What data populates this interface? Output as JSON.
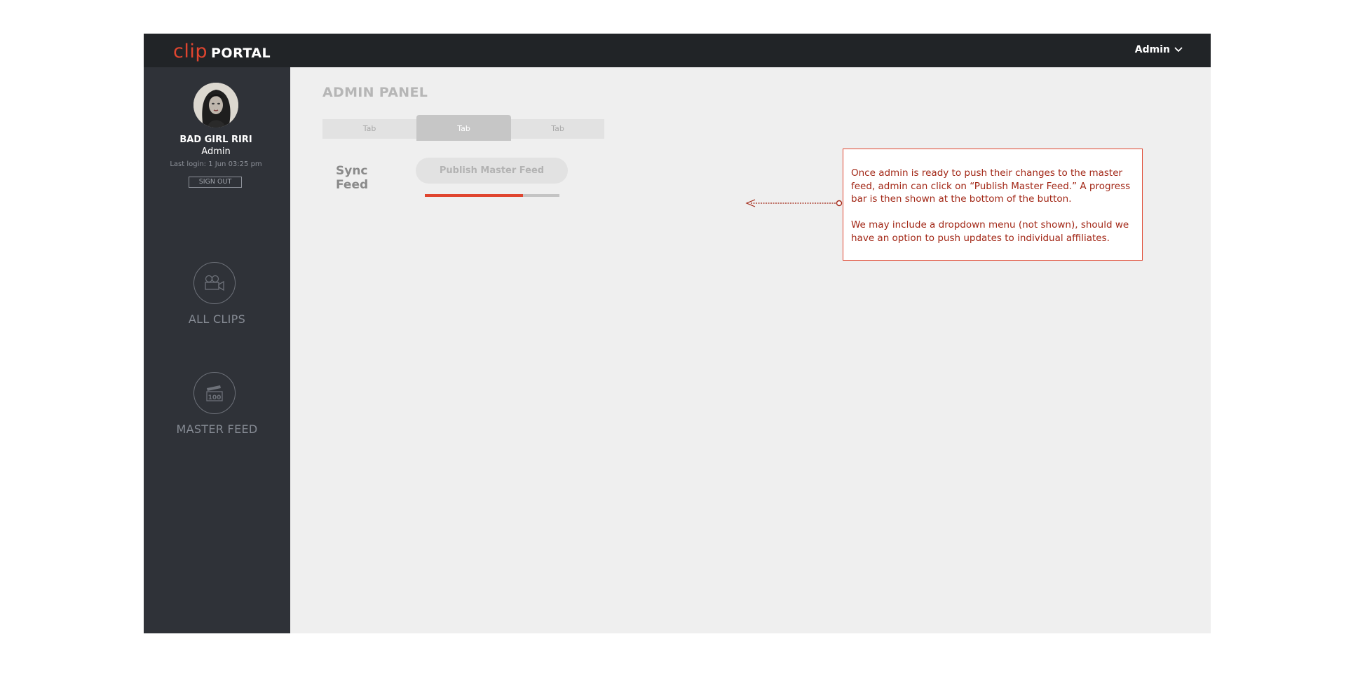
{
  "brand": {
    "clip": "clip",
    "portal": "PORTAL",
    "accent_color": "#e0452f"
  },
  "header": {
    "user_menu_label": "Admin",
    "user_menu_icon": "chevron-down-icon"
  },
  "sidebar": {
    "user": {
      "name": "BAD GIRL RIRI",
      "role": "Admin",
      "last_login": "Last login: 1 Jun 03:25 pm",
      "sign_out_label": "SIGN OUT"
    },
    "nav": [
      {
        "label": "ALL CLIPS",
        "icon": "video-camera-icon"
      },
      {
        "label": "MASTER FEED",
        "icon": "clapperboard-feed-icon"
      }
    ]
  },
  "main": {
    "title": "ADMIN PANEL",
    "tabs": [
      {
        "label": "Tab",
        "active": false
      },
      {
        "label": "Tab",
        "active": true
      },
      {
        "label": "Tab",
        "active": false
      }
    ],
    "sync": {
      "label": "Sync Feed",
      "button_label": "Publish Master Feed",
      "progress_percent": 73
    }
  },
  "annotation": {
    "paragraph1": "Once admin is ready to push their changes to the master feed, admin can click on “Publish Master Feed.” A progress bar is then shown at the bottom of the button.",
    "paragraph2": "We may include a dropdown menu (not shown), should we have an option to push updates to individual affiliates."
  }
}
